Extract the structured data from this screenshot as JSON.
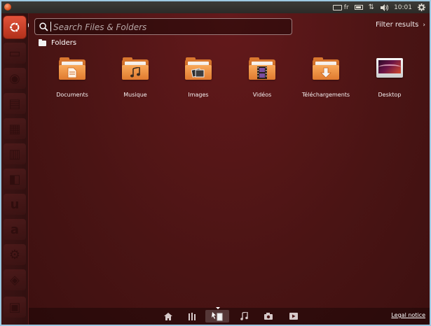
{
  "top_panel": {
    "keyboard_layout": "fr",
    "clock": "10:01",
    "icons": [
      "keyboard-icon",
      "battery-icon",
      "network-icon",
      "volume-icon",
      "gear-icon"
    ]
  },
  "launcher": {
    "items": [
      {
        "name": "files-icon"
      },
      {
        "name": "firefox-icon"
      },
      {
        "name": "writer-icon"
      },
      {
        "name": "calc-icon"
      },
      {
        "name": "impress-icon"
      },
      {
        "name": "software-center-icon"
      },
      {
        "name": "ubuntu-one-icon"
      },
      {
        "name": "amazon-icon"
      },
      {
        "name": "settings-icon"
      },
      {
        "name": "trash-icon"
      }
    ]
  },
  "dash": {
    "search": {
      "placeholder": "Search Files & Folders",
      "value": ""
    },
    "filter_results_label": "Filter results",
    "section_title": "Folders",
    "folders": [
      {
        "label": "Documents",
        "emblem": "document-icon"
      },
      {
        "label": "Musique",
        "emblem": "music-note-icon"
      },
      {
        "label": "Images",
        "emblem": "photos-icon"
      },
      {
        "label": "Vidéos",
        "emblem": "film-icon"
      },
      {
        "label": "Téléchargements",
        "emblem": "download-arrow-icon"
      },
      {
        "label": "Desktop",
        "emblem": "desktop-icon"
      }
    ],
    "legal_notice": "Legal notice",
    "lenses": [
      "home-lens-icon",
      "apps-lens-icon",
      "files-lens-icon",
      "music-lens-icon",
      "photos-lens-icon",
      "video-lens-icon"
    ],
    "active_lens": "files-lens-icon"
  },
  "colors": {
    "dash_background": "#4a1414",
    "bfb_orange": "#dd4814",
    "folder_orange": "#f39c4a"
  }
}
